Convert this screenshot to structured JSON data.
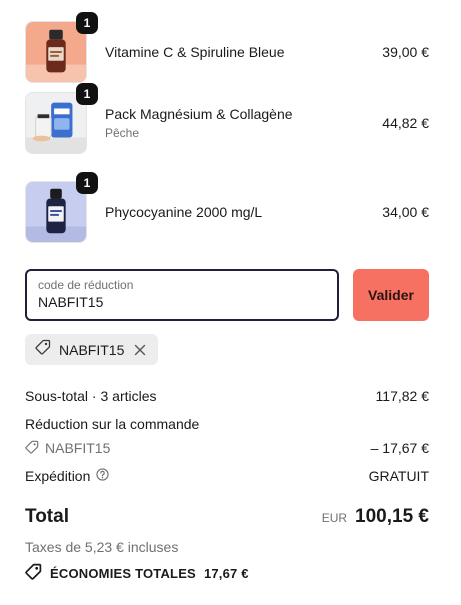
{
  "currency_symbol": "€",
  "products": [
    {
      "name": "Vitamine C & Spiruline Bleue",
      "variant": "",
      "price": "39,00 €",
      "quantity": "1",
      "image_icon": "orange-bottle-icon"
    },
    {
      "name": "Pack Magnésium & Collagène",
      "variant": "Pêche",
      "price": "44,82 €",
      "quantity": "1",
      "image_icon": "supplement-pack-icon"
    },
    {
      "name": "Phycocyanine 2000 mg/L",
      "variant": "",
      "price": "34,00 €",
      "quantity": "1",
      "image_icon": "blue-bottle-icon"
    }
  ],
  "discount": {
    "field_label": "code de réduction",
    "field_value": "NABFIT15",
    "apply_label": "Valider",
    "applied_code": "NABFIT15",
    "remove_icon": "close-icon"
  },
  "summary": {
    "subtotal_label": "Sous-total · 3 articles",
    "subtotal_value": "117,82 €",
    "order_discount_label": "Réduction sur la commande",
    "order_discount_code": "NABFIT15",
    "order_discount_value": "– 17,67 €",
    "shipping_label": "Expédition",
    "shipping_value": "GRATUIT",
    "total_label": "Total",
    "total_currency": "EUR",
    "total_value": "100,15 €",
    "taxes_note": "Taxes de 5,23 € incluses",
    "savings_label": "ÉCONOMIES TOTALES",
    "savings_value": "17,67 €"
  },
  "colors": {
    "accent_button": "#f67161",
    "field_border": "#1f2137",
    "chip_background": "#ededed",
    "badge": "#111111"
  }
}
